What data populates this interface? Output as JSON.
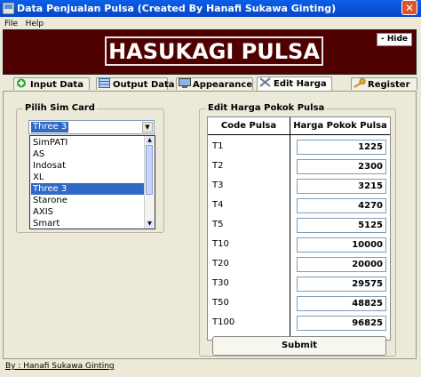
{
  "window": {
    "title": "Data Penjualan Pulsa (Created By Hanafi Sukawa Ginting)"
  },
  "menu": [
    "File",
    "Help"
  ],
  "banner": {
    "title": "HASUKAGI PULSA",
    "hide_label": "- Hide"
  },
  "tabs": [
    {
      "label": "Input Data",
      "icon": "plus-icon"
    },
    {
      "label": "Output Data",
      "icon": "table-icon"
    },
    {
      "label": "Appearance",
      "icon": "monitor-icon"
    },
    {
      "label": "Edit Harga",
      "icon": "tools-icon"
    },
    {
      "label": "Register",
      "icon": "key-icon"
    }
  ],
  "sim_card": {
    "label": "Pilih Sim Card",
    "selected": "Three 3",
    "options": [
      "SimPATI",
      "AS",
      "Indosat",
      "XL",
      "Three 3",
      "Starone",
      "AXIS",
      "Smart"
    ]
  },
  "harga": {
    "label": "Edit Harga Pokok Pulsa",
    "col_code": "Code Pulsa",
    "col_price": "Harga Pokok Pulsa",
    "rows": [
      {
        "code": "T1",
        "price": "1225"
      },
      {
        "code": "T2",
        "price": "2300"
      },
      {
        "code": "T3",
        "price": "3215"
      },
      {
        "code": "T4",
        "price": "4270"
      },
      {
        "code": "T5",
        "price": "5125"
      },
      {
        "code": "T10",
        "price": "10000"
      },
      {
        "code": "T20",
        "price": "20000"
      },
      {
        "code": "T30",
        "price": "29575"
      },
      {
        "code": "T50",
        "price": "48825"
      },
      {
        "code": "T100",
        "price": "96825"
      }
    ],
    "submit_label": "Submit"
  },
  "footer": "By : Hanafi Sukawa Ginting"
}
